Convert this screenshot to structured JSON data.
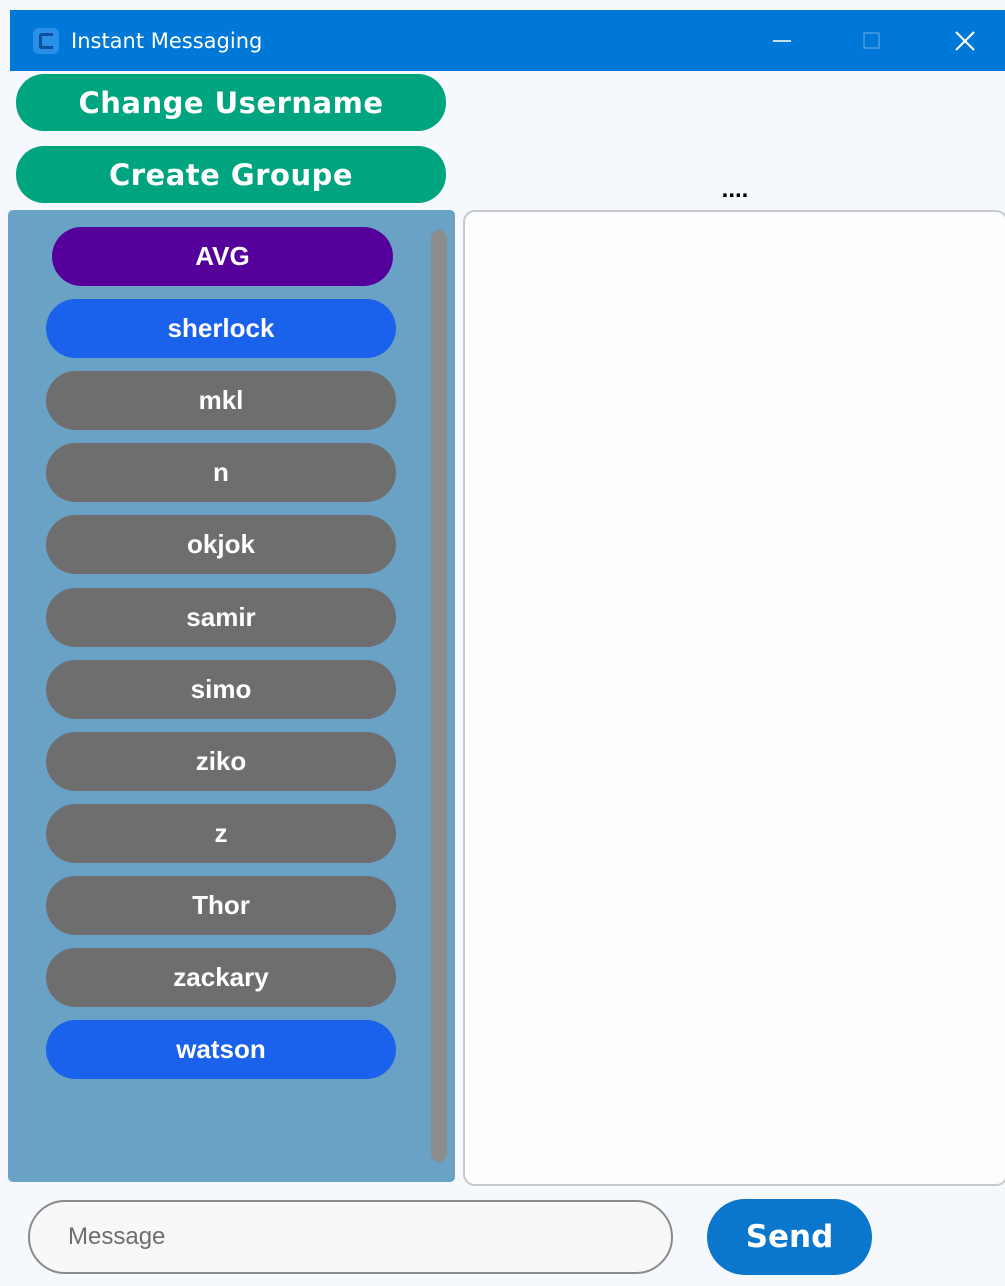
{
  "window": {
    "title": "Instant Messaging",
    "minimize_icon": "minimize-icon",
    "maximize_icon": "maximize-icon",
    "close_icon": "close-icon",
    "bar_color": "#0078d7"
  },
  "actions": {
    "change_username": "Change Username",
    "create_groupe": "Create Groupe",
    "button_color": "#00a47e"
  },
  "chat": {
    "title": "...."
  },
  "users": [
    {
      "name": "AVG",
      "color": "#55009a"
    },
    {
      "name": "sherlock",
      "color": "#1a61eb"
    },
    {
      "name": "mkl",
      "color": "#6e6e6e"
    },
    {
      "name": "n",
      "color": "#6e6e6e"
    },
    {
      "name": "okjok",
      "color": "#6e6e6e"
    },
    {
      "name": "samir",
      "color": "#6e6e6e"
    },
    {
      "name": "simo",
      "color": "#6e6e6e"
    },
    {
      "name": "ziko",
      "color": "#6e6e6e"
    },
    {
      "name": "z",
      "color": "#6e6e6e"
    },
    {
      "name": "Thor",
      "color": "#6e6e6e"
    },
    {
      "name": "zackary",
      "color": "#6e6e6e"
    },
    {
      "name": "watson",
      "color": "#1a61eb"
    }
  ],
  "composer": {
    "placeholder": "Message",
    "value": "",
    "send_label": "Send"
  }
}
